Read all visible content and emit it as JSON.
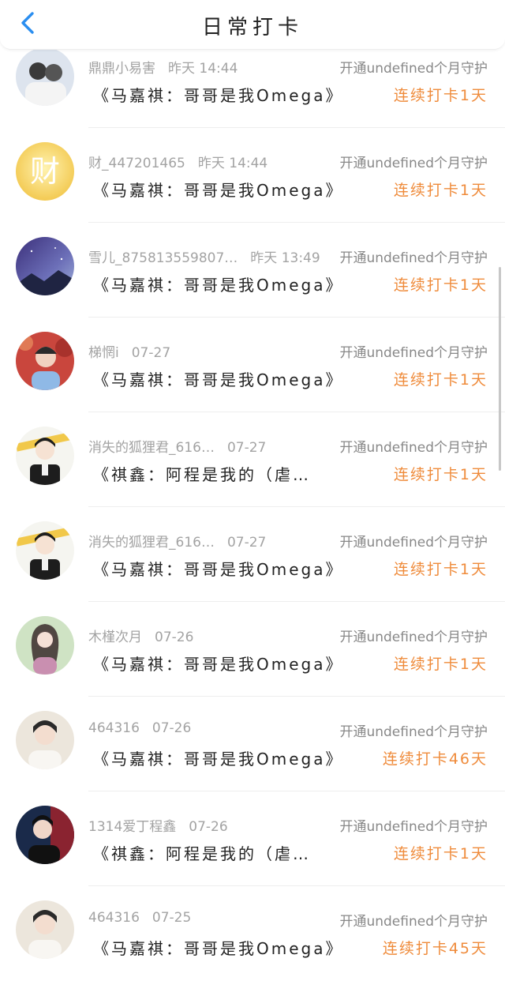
{
  "header": {
    "title": "日常打卡",
    "back_icon": "chevron-left-icon"
  },
  "colors": {
    "accent": "#ef8b3b",
    "back": "#2a8ef0",
    "muted": "#a3a3a3"
  },
  "rows": [
    {
      "name": "鼎鼎小易害",
      "time": "昨天 14:44",
      "guard": "开通undefined个月守护",
      "book": "《马嘉祺：哥哥是我Omega》",
      "streak": "连续打卡1天"
    },
    {
      "name": "财_447201465",
      "time": "昨天 14:44",
      "guard": "开通undefined个月守护",
      "book": "《马嘉祺：哥哥是我Omega》",
      "streak": "连续打卡1天"
    },
    {
      "name": "雪儿_875813559807…",
      "time": "昨天 13:49",
      "guard": "开通undefined个月守护",
      "book": "《马嘉祺：哥哥是我Omega》",
      "streak": "连续打卡1天"
    },
    {
      "name": "梯惘i",
      "time": "07-27",
      "guard": "开通undefined个月守护",
      "book": "《马嘉祺：哥哥是我Omega》",
      "streak": "连续打卡1天"
    },
    {
      "name": "消失的狐狸君_616…",
      "time": "07-27",
      "guard": "开通undefined个月守护",
      "book": "《祺鑫：阿程是我的（虐…",
      "streak": "连续打卡1天"
    },
    {
      "name": "消失的狐狸君_616…",
      "time": "07-27",
      "guard": "开通undefined个月守护",
      "book": "《马嘉祺：哥哥是我Omega》",
      "streak": "连续打卡1天"
    },
    {
      "name": "木槿次月",
      "time": "07-26",
      "guard": "开通undefined个月守护",
      "book": "《马嘉祺：哥哥是我Omega》",
      "streak": "连续打卡1天"
    },
    {
      "name": "464316",
      "time": "07-26",
      "guard": "开通undefined个月守护",
      "book": "《马嘉祺：哥哥是我Omega》",
      "streak": "连续打卡46天"
    },
    {
      "name": "1314爱丁程鑫",
      "time": "07-26",
      "guard": "开通undefined个月守护",
      "book": "《祺鑫：阿程是我的（虐…",
      "streak": "连续打卡1天"
    },
    {
      "name": "464316",
      "time": "07-25",
      "guard": "开通undefined个月守护",
      "book": "《马嘉祺：哥哥是我Omega》",
      "streak": "连续打卡45天"
    }
  ]
}
